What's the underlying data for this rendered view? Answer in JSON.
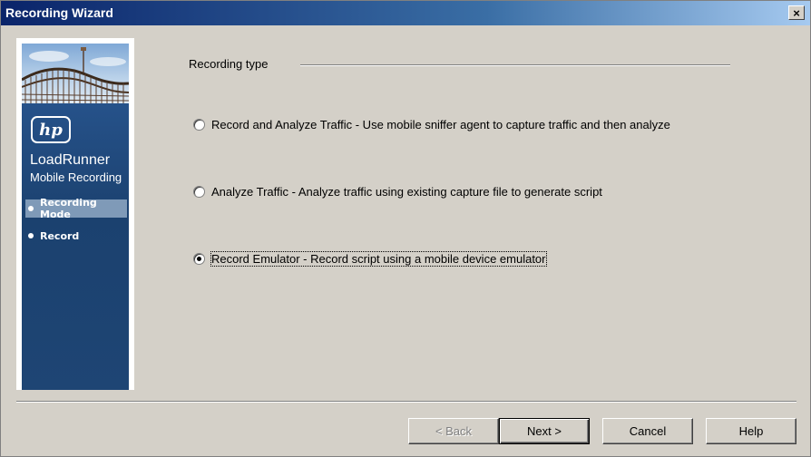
{
  "window": {
    "title": "Recording Wizard",
    "close_glyph": "×",
    "close_icon": "close-icon"
  },
  "banner": {
    "logo": "hp",
    "product_name": "LoadRunner",
    "product_subtitle": "Mobile Recording",
    "steps": [
      {
        "label": "Recording Mode",
        "active": true
      },
      {
        "label": "Record",
        "active": false
      }
    ],
    "colors": {
      "panel": "#1e4574",
      "active_step": "#7f9ab8"
    }
  },
  "recording_type": {
    "label": "Recording type",
    "options": [
      {
        "label": "Record and Analyze Traffic - Use mobile sniffer agent to capture traffic and then analyze",
        "selected": false
      },
      {
        "label": "Analyze Traffic - Analyze traffic using existing capture file to generate script",
        "selected": false
      },
      {
        "label": "Record Emulator -  Record script using a mobile device emulator",
        "selected": true
      }
    ]
  },
  "buttons": {
    "back": "< Back",
    "next": "Next >",
    "cancel": "Cancel",
    "help": "Help"
  }
}
